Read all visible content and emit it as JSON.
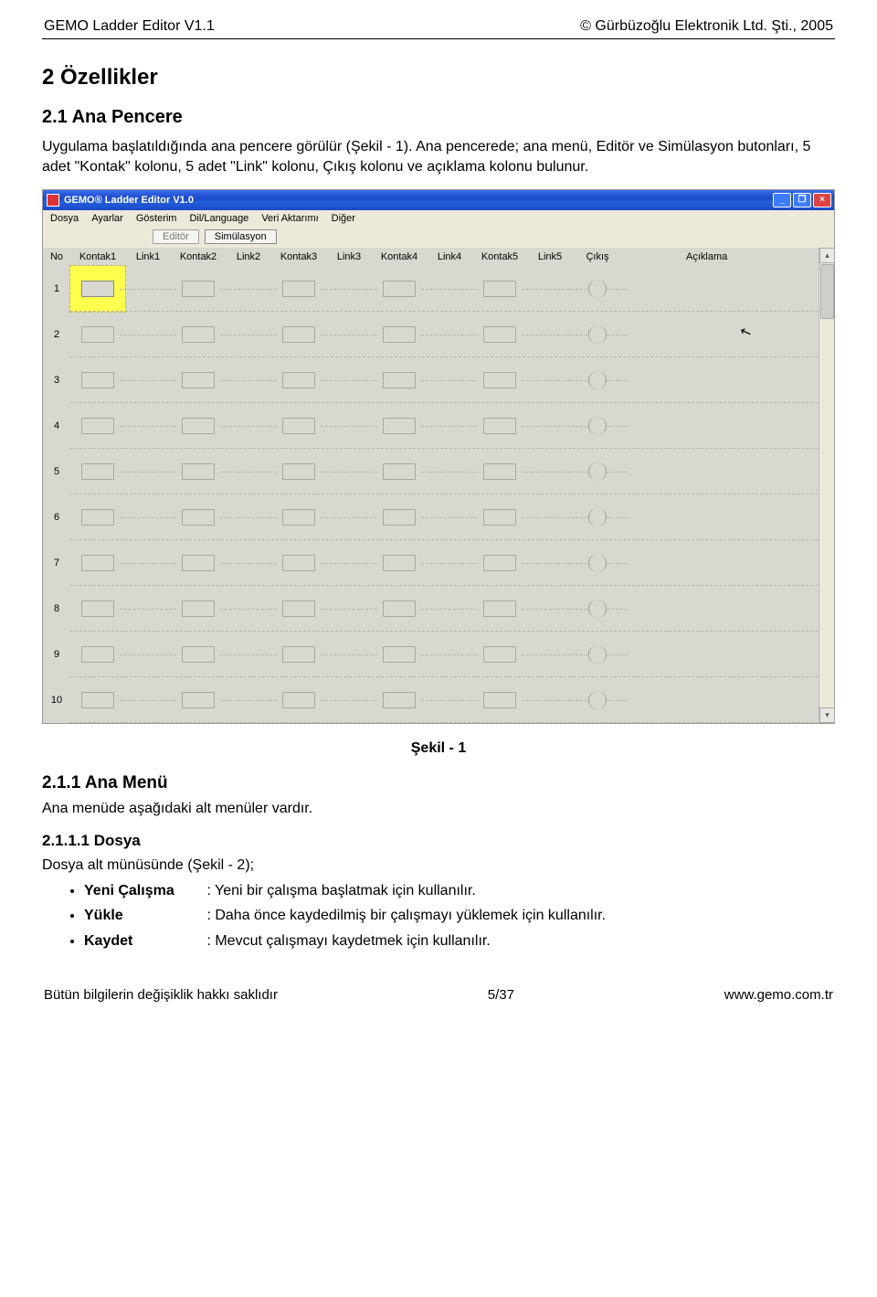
{
  "doc_header": {
    "left": "GEMO Ladder Editor V1.1",
    "right": "© Gürbüzoğlu Elektronik Ltd. Şti., 2005"
  },
  "h1": "2  Özellikler",
  "h2": "2.1  Ana Pencere",
  "p1": "Uygulama başlatıldığında ana pencere görülür (Şekil - 1). Ana pencerede; ana menü, Editör ve Simülasyon butonları, 5 adet \"Kontak\" kolonu, 5 adet \"Link\" kolonu, Çıkış kolonu ve açıklama kolonu bulunur.",
  "figure_caption": "Şekil - 1",
  "h3": "2.1.1  Ana Menü",
  "p2": "Ana menüde aşağıdaki alt menüler vardır.",
  "h4": "2.1.1.1  Dosya",
  "p3": "Dosya alt münüsünde (Şekil - 2);",
  "bullets": [
    {
      "label": "Yeni Çalışma",
      "def": ": Yeni bir çalışma başlatmak için kullanılır."
    },
    {
      "label": "Yükle",
      "def": ": Daha önce kaydedilmiş bir çalışmayı yüklemek için kullanılır."
    },
    {
      "label": "Kaydet",
      "def": ": Mevcut çalışmayı kaydetmek için kullanılır."
    }
  ],
  "doc_footer": {
    "left": "Bütün bilgilerin değişiklik hakkı saklıdır",
    "center": "5/37",
    "right": "www.gemo.com.tr"
  },
  "app": {
    "title": "GEMO® Ladder Editor V1.0",
    "menubar": [
      "Dosya",
      "Ayarlar",
      "Gösterim",
      "Dil/Language",
      "Veri Aktarımı",
      "Diğer"
    ],
    "toolbar": {
      "editor": "Editör",
      "sim": "Simülasyon"
    },
    "columns": {
      "no": "No",
      "k1": "Kontak1",
      "l1": "Link1",
      "k2": "Kontak2",
      "l2": "Link2",
      "k3": "Kontak3",
      "l3": "Link3",
      "k4": "Kontak4",
      "l4": "Link4",
      "k5": "Kontak5",
      "l5": "Link5",
      "out": "Çıkış",
      "desc": "Açıklama"
    },
    "rows": [
      1,
      2,
      3,
      4,
      5,
      6,
      7,
      8,
      9,
      10
    ],
    "win_controls": {
      "min": "_",
      "max": "❐",
      "close": "×"
    }
  }
}
